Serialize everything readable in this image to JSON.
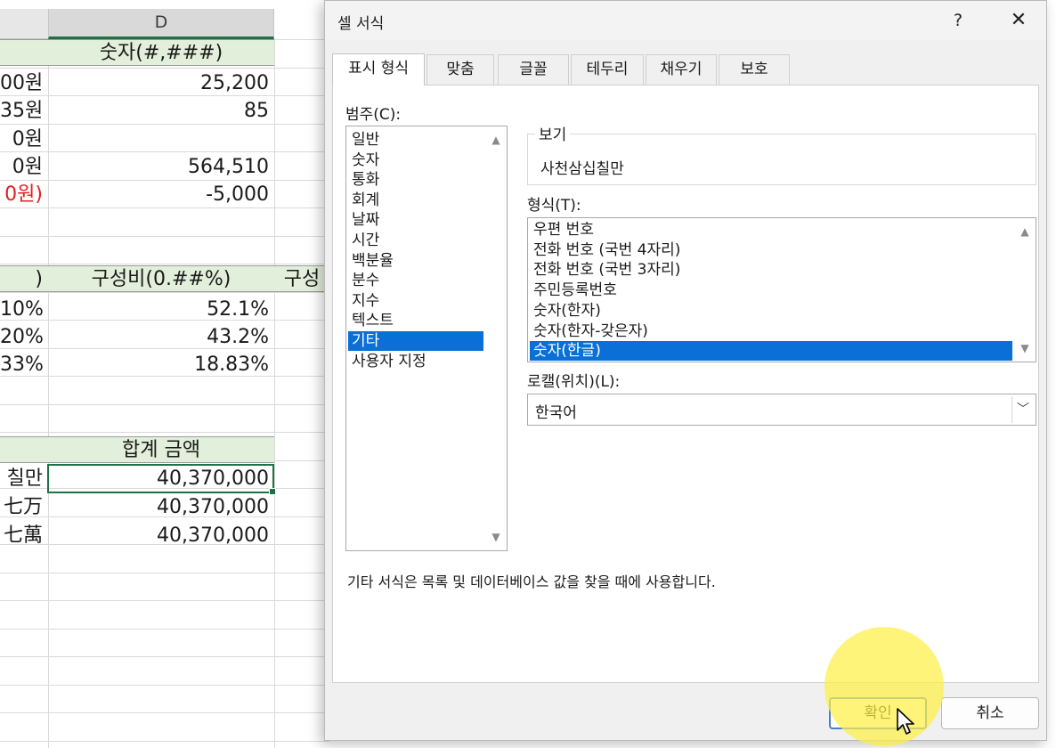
{
  "sheet": {
    "column_letter": "D",
    "rows": [
      {
        "left": "",
        "right": "숫자(#,###)",
        "header": true
      },
      {
        "left": "00원",
        "right": "25,200"
      },
      {
        "left": "35원",
        "right": "85"
      },
      {
        "left": "0원",
        "right": ""
      },
      {
        "left": "0원",
        "right": "564,510"
      },
      {
        "left": "0원)",
        "right": "-5,000",
        "left_negative": true
      },
      {
        "left": "",
        "right": ""
      },
      {
        "left": ")",
        "right": "구성비(0.##%)",
        "header": true,
        "extra": "구성"
      },
      {
        "left": "10%",
        "right": "52.1%"
      },
      {
        "left": "20%",
        "right": "43.2%"
      },
      {
        "left": "33%",
        "right": "18.83%"
      },
      {
        "left": "",
        "right": ""
      },
      {
        "left": "",
        "right": ""
      },
      {
        "left": "",
        "right": "합계 금액",
        "header": true
      },
      {
        "left": "칠만",
        "right": "40,370,000"
      },
      {
        "left": "七万",
        "right": "40,370,000"
      },
      {
        "left": "七萬",
        "right": "40,370,000"
      }
    ]
  },
  "dialog": {
    "title": "셀 서식",
    "help": "?",
    "close": "✕",
    "tabs": [
      "표시 형식",
      "맞춤",
      "글꼴",
      "테두리",
      "채우기",
      "보호"
    ],
    "category_label": "범주(C):",
    "categories": [
      "일반",
      "숫자",
      "통화",
      "회계",
      "날짜",
      "시간",
      "백분율",
      "분수",
      "지수",
      "텍스트",
      "기타",
      "사용자 지정"
    ],
    "selected_category": "기타",
    "sample_label": "보기",
    "sample_value": "사천삼십칠만",
    "type_label": "형식(T):",
    "types": [
      "우편 번호",
      "전화 번호 (국번 4자리)",
      "전화 번호 (국번 3자리)",
      "주민등록번호",
      "숫자(한자)",
      "숫자(한자-갖은자)",
      "숫자(한글)"
    ],
    "selected_type": "숫자(한글)",
    "locale_label": "로캘(위치)(L):",
    "locale_value": "한국어",
    "description": "기타 서식은 목록 및 데이터베이스 값을 찾을 때에 사용합니다.",
    "ok": "확인",
    "cancel": "취소"
  },
  "colors": {
    "header_fill": "#e2efda",
    "selection": "#0a6fd6",
    "negative": "#e0201f",
    "excel_green": "#1e7145"
  }
}
